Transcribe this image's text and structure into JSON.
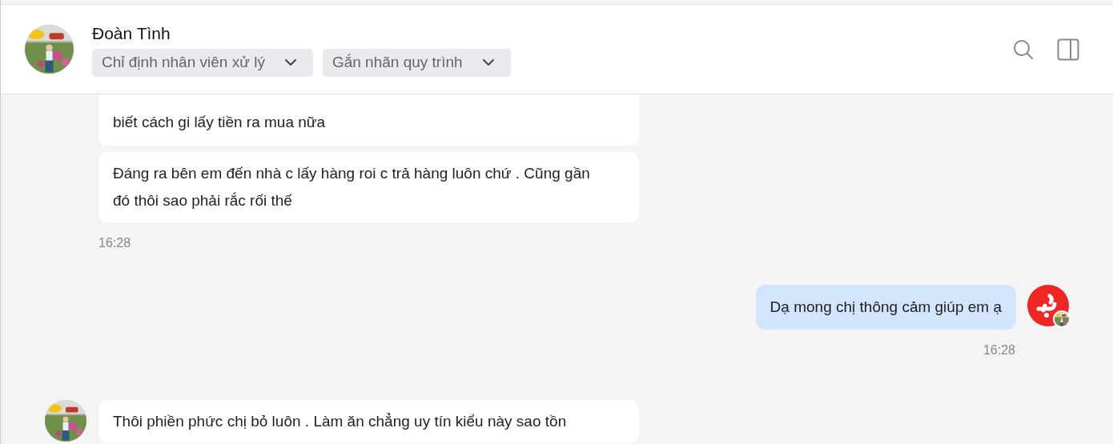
{
  "header": {
    "name": "Đoàn Tình",
    "dropdowns": [
      {
        "label": "Chỉ định nhân viên xử lý"
      },
      {
        "label": "Gắn nhãn quy trình"
      }
    ]
  },
  "messages": [
    {
      "kind": "incoming",
      "avatar": false,
      "text": "biết cách gi lấy tiền ra mua nữa"
    },
    {
      "kind": "incoming",
      "avatar": false,
      "text": "Đáng ra bên em đến nhà c lấy hàng roi c trả hàng luôn chứ . Cũng gần đó thôi sao phải rắc rối thế",
      "time": "16:28"
    },
    {
      "kind": "outgoing",
      "avatar": true,
      "text": "Dạ mong chị thông cảm giúp em ạ",
      "time": "16:28"
    },
    {
      "kind": "incoming",
      "avatar": true,
      "text": "Thôi phiền phức chị bỏ luôn . Làm ăn chẳng uy tín kiểu này sao tồn"
    }
  ]
}
